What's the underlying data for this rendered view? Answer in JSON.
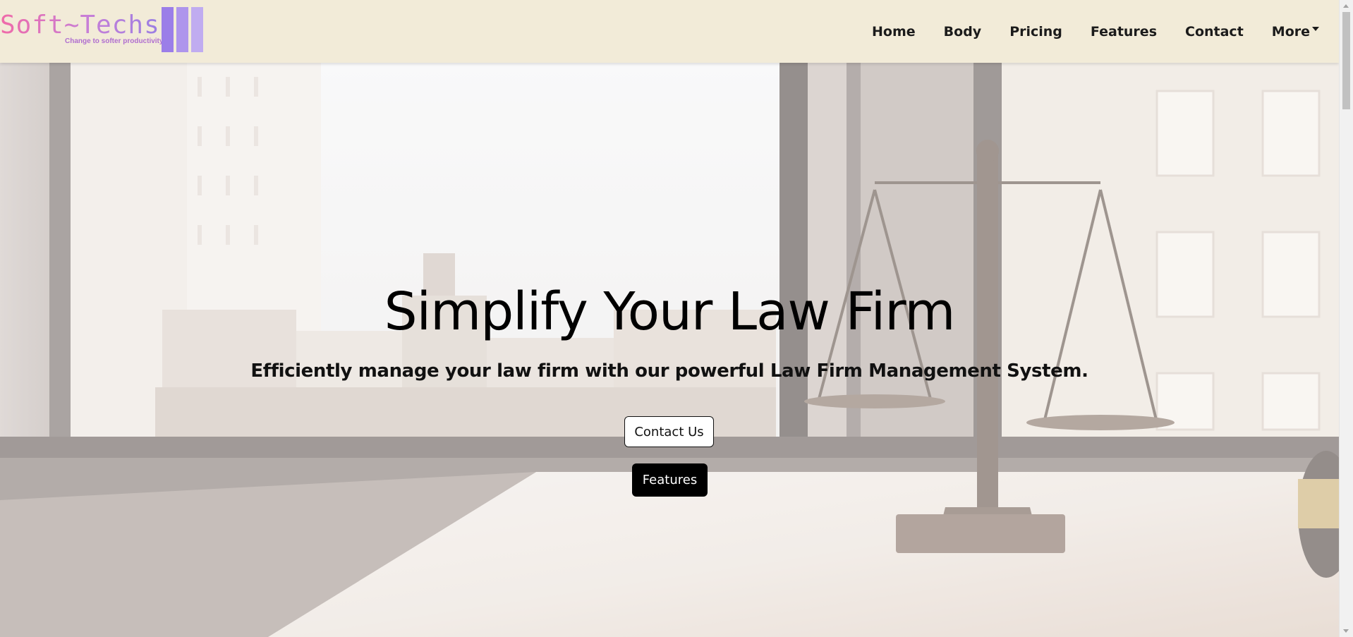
{
  "brand": {
    "name": "Soft~Techs",
    "tagline": "Change to softer productivity"
  },
  "nav": {
    "items": [
      {
        "label": "Home"
      },
      {
        "label": "Body"
      },
      {
        "label": "Pricing"
      },
      {
        "label": "Features"
      },
      {
        "label": "Contact"
      }
    ],
    "more_label": "More"
  },
  "hero": {
    "title": "Simplify Your Law Firm",
    "subtitle": "Efficiently manage your law firm with our powerful Law Firm Management System.",
    "contact_button": "Contact Us",
    "features_button": "Features",
    "background": "law-office-scales-of-justice-photo"
  },
  "colors": {
    "navbar_bg": "#f2ebd8",
    "brand_gradient_start": "#f06aa8",
    "brand_gradient_end": "#9a7fe3",
    "primary_button_bg": "#000000",
    "secondary_button_bg": "#ffffff"
  }
}
